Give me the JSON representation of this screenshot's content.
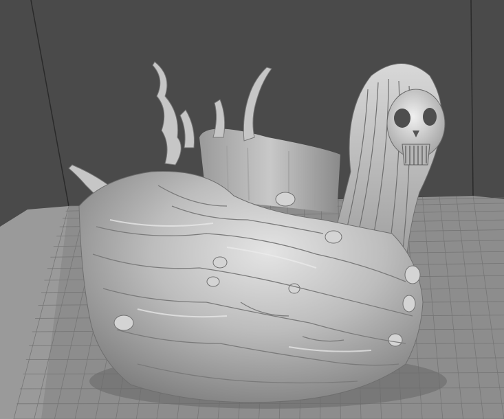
{
  "viewport": {
    "background_color": "#4a4a4a",
    "wall_line_color": "#2a2a2a",
    "bed_color": "#8d8d8d",
    "bed_grid_color": "#757575",
    "bed_edge_color": "#a0a0a0"
  },
  "model": {
    "description_icon": "3d-model-skull-ghost-cup",
    "base_color": "#b9b9b9",
    "highlight_color": "#e6e6e6",
    "shadow_color": "#6e6e6e"
  }
}
